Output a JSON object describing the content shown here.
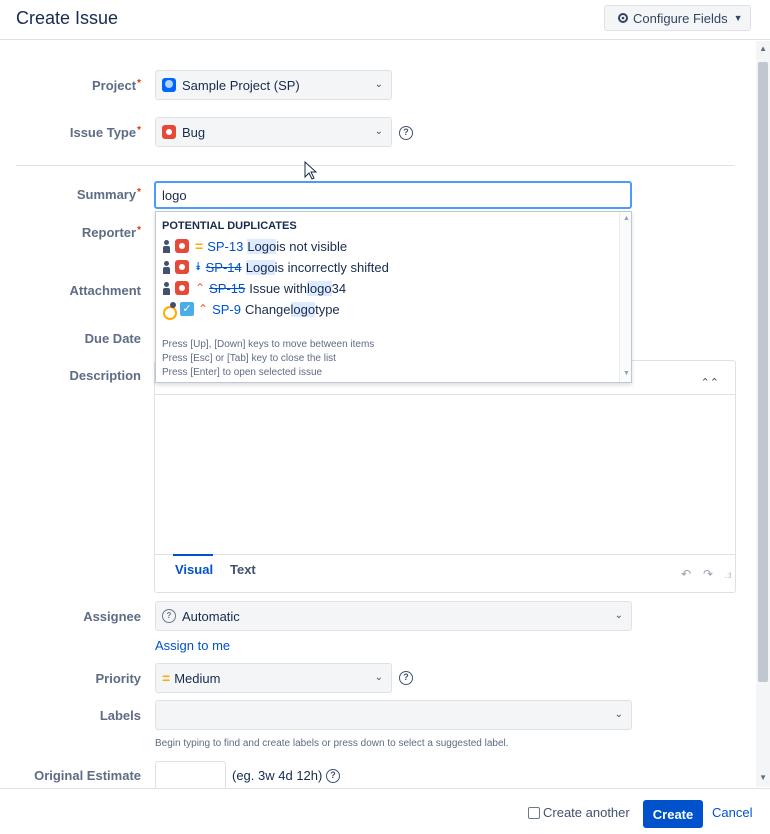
{
  "header": {
    "title": "Create Issue",
    "configure_label": "Configure Fields"
  },
  "fields": {
    "project": {
      "label": "Project",
      "value": "Sample Project (SP)"
    },
    "issue_type": {
      "label": "Issue Type",
      "value": "Bug"
    },
    "summary": {
      "label": "Summary",
      "value": "logo"
    },
    "reporter": {
      "label": "Reporter"
    },
    "attachment": {
      "label": "Attachment"
    },
    "due_date": {
      "label": "Due Date"
    },
    "description": {
      "label": "Description",
      "tab_visual": "Visual",
      "tab_text": "Text"
    },
    "assignee": {
      "label": "Assignee",
      "value": "Automatic",
      "assign_to_me": "Assign to me"
    },
    "priority": {
      "label": "Priority",
      "value": "Medium"
    },
    "labels": {
      "label": "Labels",
      "hint": "Begin typing to find and create labels or press down to select a suggested label."
    },
    "original_estimate": {
      "label": "Original Estimate",
      "hint": "(eg. 3w 4d 12h)"
    }
  },
  "required_mark": "*",
  "duplicates": {
    "heading": "POTENTIAL DUPLICATES",
    "items": [
      {
        "key": "SP-13",
        "pre": "",
        "match": "Logo",
        "post": " is not visible",
        "resolved": false
      },
      {
        "key": "SP-14",
        "pre": "",
        "match": "Logo",
        "post": " is incorrectly shifted",
        "resolved": true
      },
      {
        "key": "SP-15",
        "pre": "Issue with ",
        "match": "logo",
        "post": " 34",
        "resolved": true
      },
      {
        "key": "SP-9",
        "pre": "Change ",
        "match": "logo",
        "post": " type",
        "resolved": false
      }
    ],
    "hints": [
      "Press [Up], [Down] keys to move between items",
      "Press [Esc] or [Tab] key to close the list",
      "Press [Enter] to open selected issue"
    ]
  },
  "footer": {
    "create_another": "Create another",
    "create": "Create",
    "cancel": "Cancel"
  },
  "colors": {
    "accent": "#0052cc",
    "focus": "#4c9aff",
    "bug": "#e5493a",
    "medium": "#ffab00"
  }
}
